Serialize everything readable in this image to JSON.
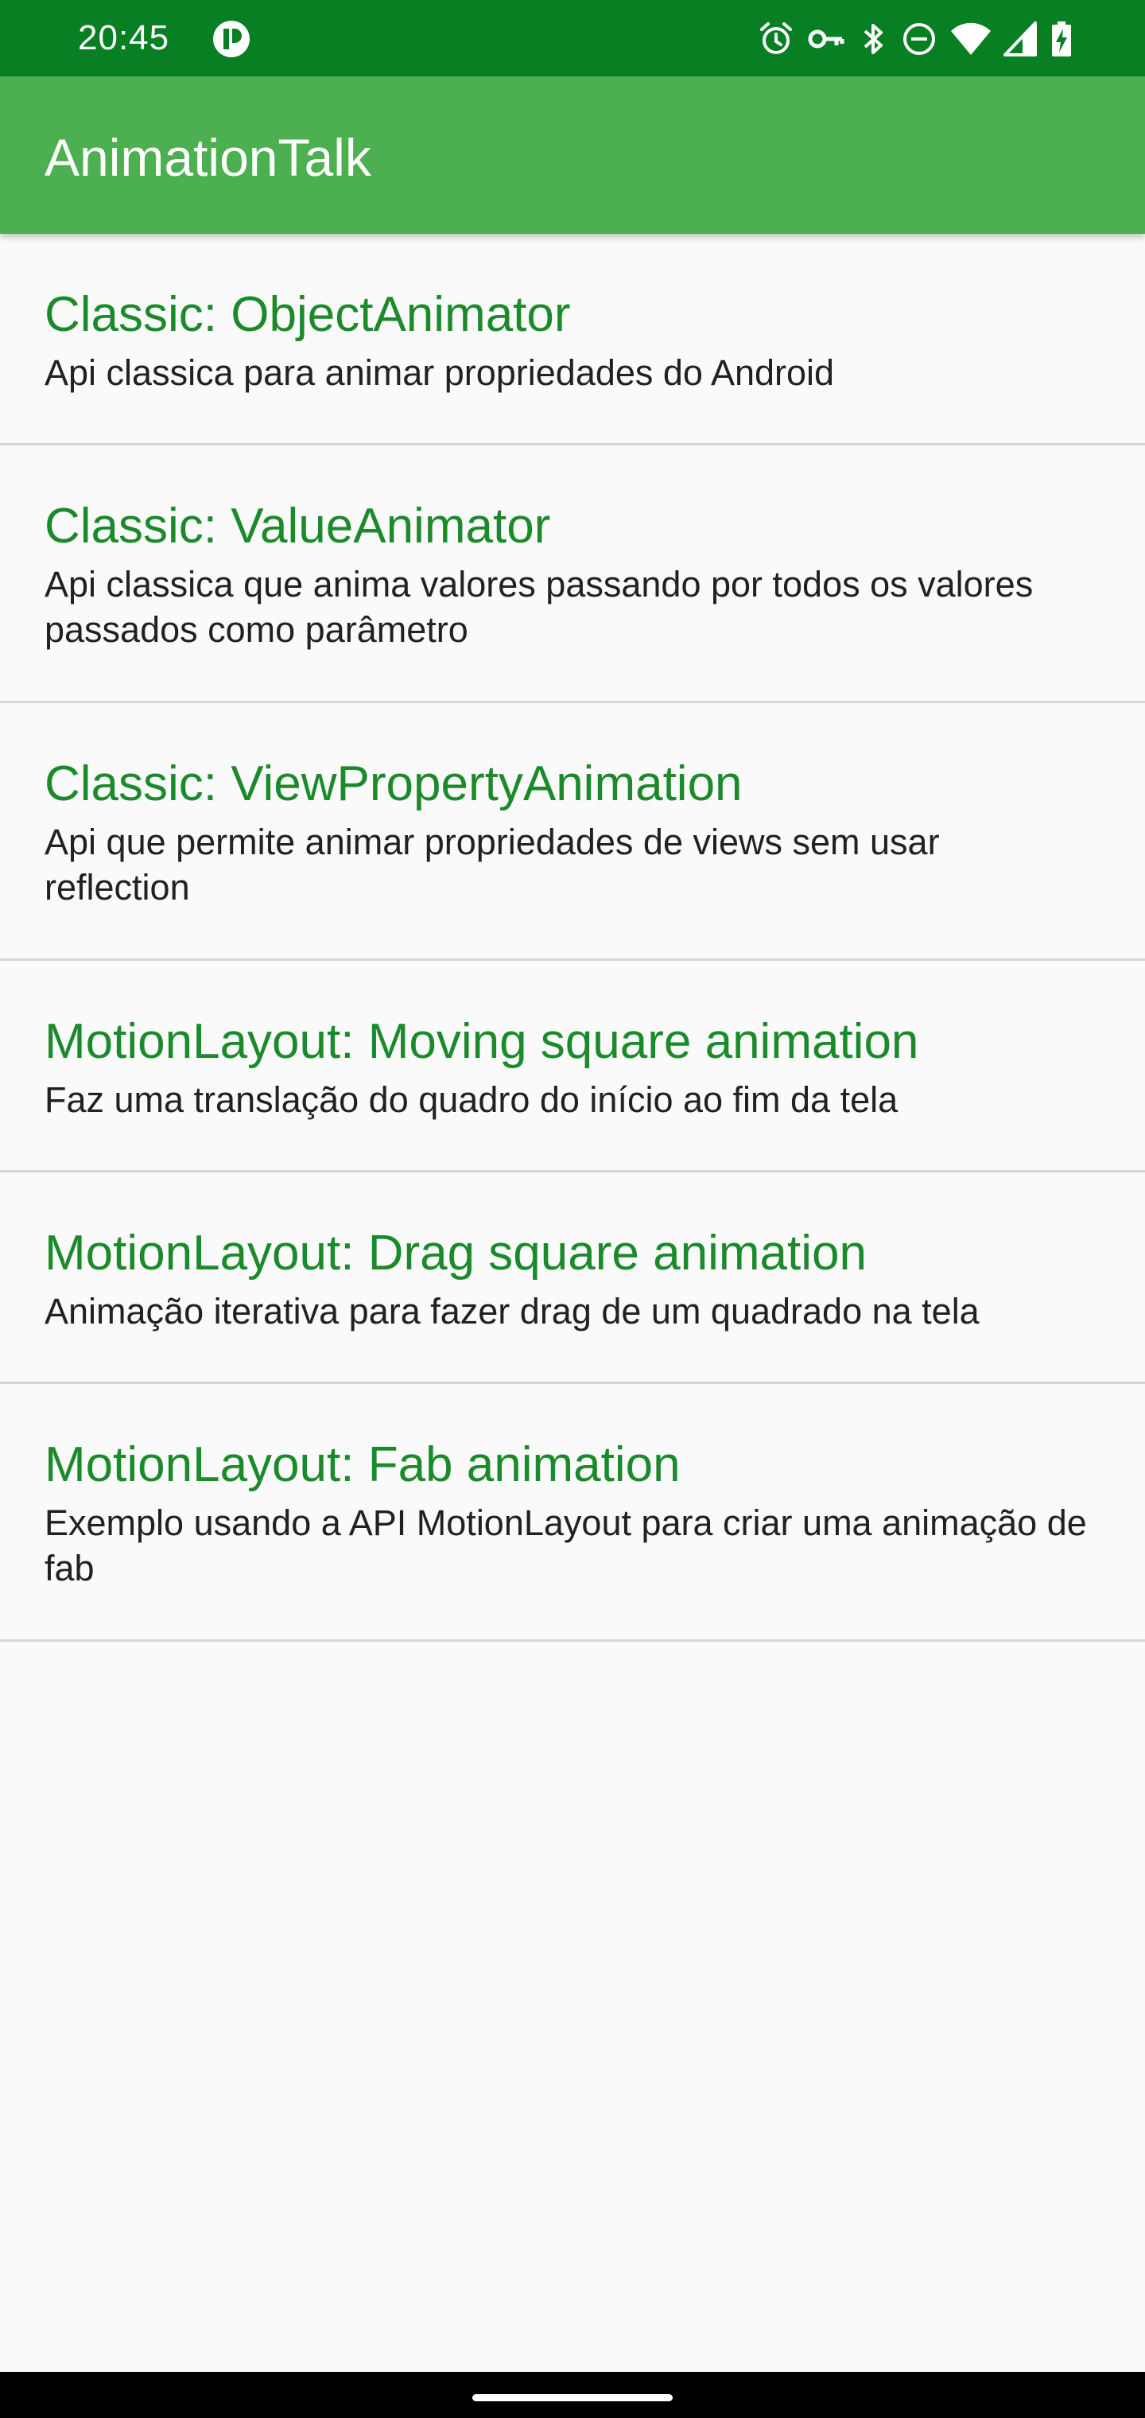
{
  "status_bar": {
    "time": "20:45",
    "icons": [
      "app-notification-icon",
      "alarm-icon",
      "vpn-key-icon",
      "bluetooth-icon",
      "do-not-disturb-icon",
      "wifi-icon",
      "cell-signal-icon",
      "battery-charging-icon"
    ],
    "background": "#087f23"
  },
  "app_bar": {
    "title": "AnimationTalk",
    "background": "#4caf50"
  },
  "list": {
    "title_color": "#1b8a2a",
    "items": [
      {
        "title": "Classic: ObjectAnimator",
        "description": "Api classica para animar propriedades do Android"
      },
      {
        "title": "Classic: ValueAnimator",
        "description": "Api classica que anima valores passando por todos os valores passados como parâmetro"
      },
      {
        "title": "Classic: ViewPropertyAnimation",
        "description": "Api que permite animar propriedades de views sem usar reflection"
      },
      {
        "title": "MotionLayout: Moving square animation",
        "description": "Faz uma translação do quadro do início ao fim da tela"
      },
      {
        "title": "MotionLayout: Drag square animation",
        "description": "Animação iterativa para fazer drag de um quadrado na tela"
      },
      {
        "title": "MotionLayout: Fab animation",
        "description": "Exemplo usando a API MotionLayout para criar uma animação de fab"
      }
    ]
  }
}
